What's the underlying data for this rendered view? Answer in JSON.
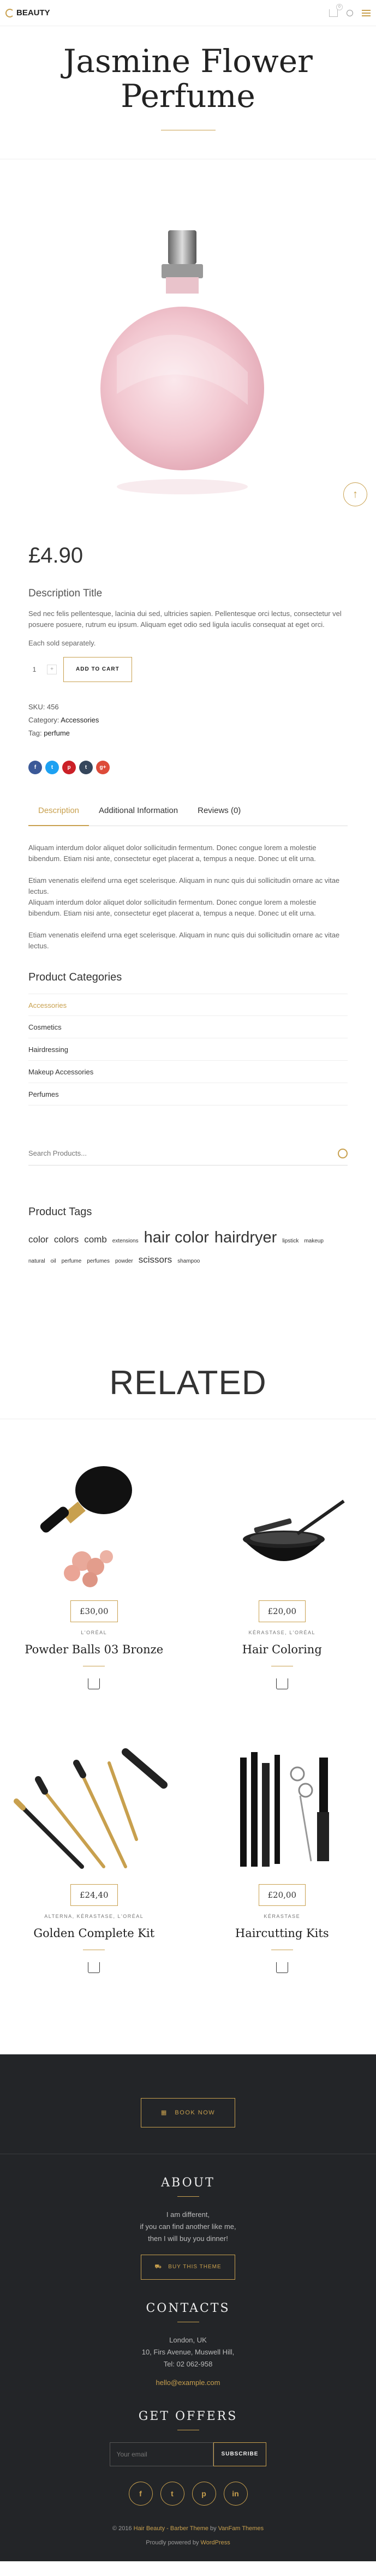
{
  "header": {
    "logo_text": "BEAUTY",
    "cart_count": "0"
  },
  "product": {
    "title_line1": "Jasmine Flower",
    "title_line2": "Perfume",
    "price": "£4.90",
    "description_title": "Description Title",
    "description": "Sed nec felis pellentesque, lacinia dui sed, ultricies sapien. Pellentesque orci lectus, consectetur vel posuere posuere, rutrum eu ipsum. Aliquam eget odio sed ligula iaculis consequat at eget orci.",
    "stock": "Each sold separately.",
    "quantity": "1",
    "qty_plus": "+",
    "add_to_cart": "ADD TO CART",
    "sku_label": "SKU:",
    "sku": "456",
    "category_label": "Category:",
    "category": "Accessories",
    "tag_label": "Tag:",
    "tag": "perfume",
    "share": [
      "f",
      "t",
      "p",
      "t",
      "g+"
    ],
    "share_colors": [
      "#3b5998",
      "#1da1f2",
      "#cb2027",
      "#35465c",
      "#dd4b39"
    ]
  },
  "tabs": [
    {
      "label": "Description"
    },
    {
      "label": "Additional Information"
    },
    {
      "label": "Reviews (0)"
    }
  ],
  "tab_content": [
    "Aliquam interdum dolor aliquet dolor sollicitudin fermentum. Donec congue lorem a molestie bibendum. Etiam nisi ante, consectetur eget placerat a, tempus a neque. Donec ut elit urna.",
    "Etiam venenatis eleifend urna eget scelerisque. Aliquam in nunc quis dui sollicitudin ornare ac vitae lectus.\nAliquam interdum dolor aliquet dolor sollicitudin fermentum. Donec congue lorem a molestie bibendum. Etiam nisi ante, consectetur eget placerat a, tempus a neque. Donec ut elit urna.",
    "Etiam venenatis eleifend urna eget scelerisque. Aliquam in nunc quis dui sollicitudin ornare ac vitae lectus."
  ],
  "sidebar": {
    "categories_title": "Product Categories",
    "categories": [
      "Accessories",
      "Cosmetics",
      "Hairdressing",
      "Makeup Accessories",
      "Perfumes"
    ],
    "search_placeholder": "Search Products...",
    "tags_title": "Product Tags",
    "tags": [
      {
        "label": "color",
        "size": 17
      },
      {
        "label": "colors",
        "size": 17
      },
      {
        "label": "comb",
        "size": 17
      },
      {
        "label": "extensions",
        "size": 10
      },
      {
        "label": "hair color",
        "size": 29
      },
      {
        "label": "hairdryer",
        "size": 29
      },
      {
        "label": "lipstick",
        "size": 10
      },
      {
        "label": "makeup",
        "size": 10
      },
      {
        "label": "natural",
        "size": 10
      },
      {
        "label": "oil",
        "size": 10
      },
      {
        "label": "perfume",
        "size": 10
      },
      {
        "label": "perfumes",
        "size": 10
      },
      {
        "label": "powder",
        "size": 10
      },
      {
        "label": "scissors",
        "size": 17
      },
      {
        "label": "shampoo",
        "size": 10
      }
    ]
  },
  "related": {
    "title": "RELATED",
    "items": [
      {
        "price": "£30,00",
        "cats": "L'ORÉAL",
        "name": "Powder Balls 03 Bronze"
      },
      {
        "price": "£20,00",
        "cats": "KÉRASTASE, L'ORÉAL",
        "name": "Hair Coloring"
      },
      {
        "price": "£24,40",
        "cats": "ALTERNA, KÉRASTASE, L'ORÉAL",
        "name": "Golden Complete Kit"
      },
      {
        "price": "£20,00",
        "cats": "KÉRASTASE",
        "name": "Haircutting Kits"
      }
    ]
  },
  "footer": {
    "book_now": "BOOK NOW",
    "about_title": "ABOUT",
    "about_lines": [
      "I am different,",
      "if you can find another like me,",
      "then I will buy you dinner!"
    ],
    "buy_theme": "BUY THIS THEME",
    "contacts_title": "CONTACTS",
    "contact_lines": [
      "London, UK",
      "10, Firs Avenue, Muswell Hill,",
      "Tel: 02 062-958"
    ],
    "email": "hello@example.com",
    "offers_title": "GET OFFERS",
    "email_placeholder": "Your email",
    "subscribe": "SUBSCRIBE",
    "socials": [
      "f",
      "t",
      "p",
      "in"
    ],
    "copyright_prefix": "© 2016",
    "copyright_link1": "Hair Beauty - Barber Theme",
    "copyright_by": " by ",
    "copyright_link2": "VanFam Themes",
    "powered_prefix": "Proudly powered by",
    "powered_link": "WordPress"
  },
  "colors": {
    "accent": "#c8a04e",
    "footer_bg": "#232528"
  }
}
